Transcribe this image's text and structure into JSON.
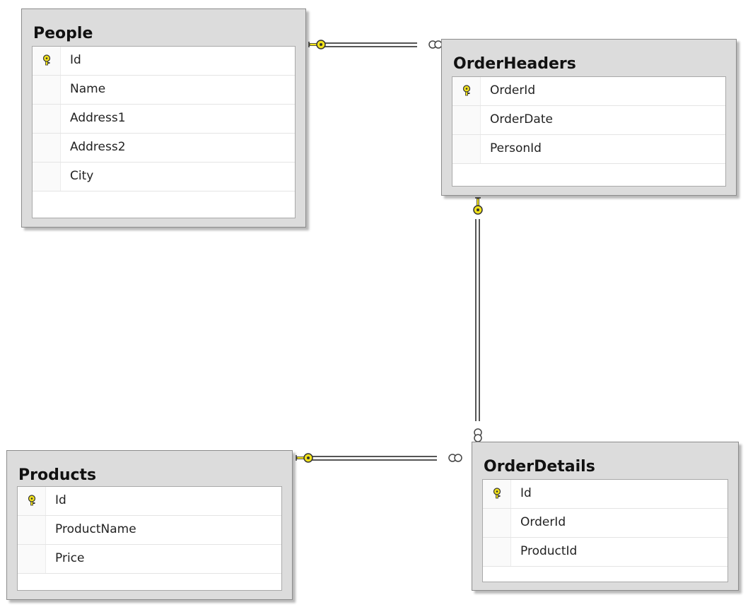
{
  "tables": [
    {
      "name": "People",
      "columns": [
        {
          "name": "Id",
          "pk": true
        },
        {
          "name": "Name",
          "pk": false
        },
        {
          "name": "Address1",
          "pk": false
        },
        {
          "name": "Address2",
          "pk": false
        },
        {
          "name": "City",
          "pk": false
        }
      ]
    },
    {
      "name": "OrderHeaders",
      "columns": [
        {
          "name": "OrderId",
          "pk": true
        },
        {
          "name": "OrderDate",
          "pk": false
        },
        {
          "name": "PersonId",
          "pk": false
        }
      ]
    },
    {
      "name": "Products",
      "columns": [
        {
          "name": "Id",
          "pk": true
        },
        {
          "name": "ProductName",
          "pk": false
        },
        {
          "name": "Price",
          "pk": false
        }
      ]
    },
    {
      "name": "OrderDetails",
      "columns": [
        {
          "name": "Id",
          "pk": true
        },
        {
          "name": "OrderId",
          "pk": false
        },
        {
          "name": "ProductId",
          "pk": false
        }
      ]
    }
  ],
  "relationships": [
    {
      "from": "People",
      "to": "OrderHeaders"
    },
    {
      "from": "OrderHeaders",
      "to": "OrderDetails"
    },
    {
      "from": "Products",
      "to": "OrderDetails"
    }
  ],
  "colors": {
    "key": "#f2e21a",
    "line": "#555555",
    "header": "#dcdcdc"
  }
}
